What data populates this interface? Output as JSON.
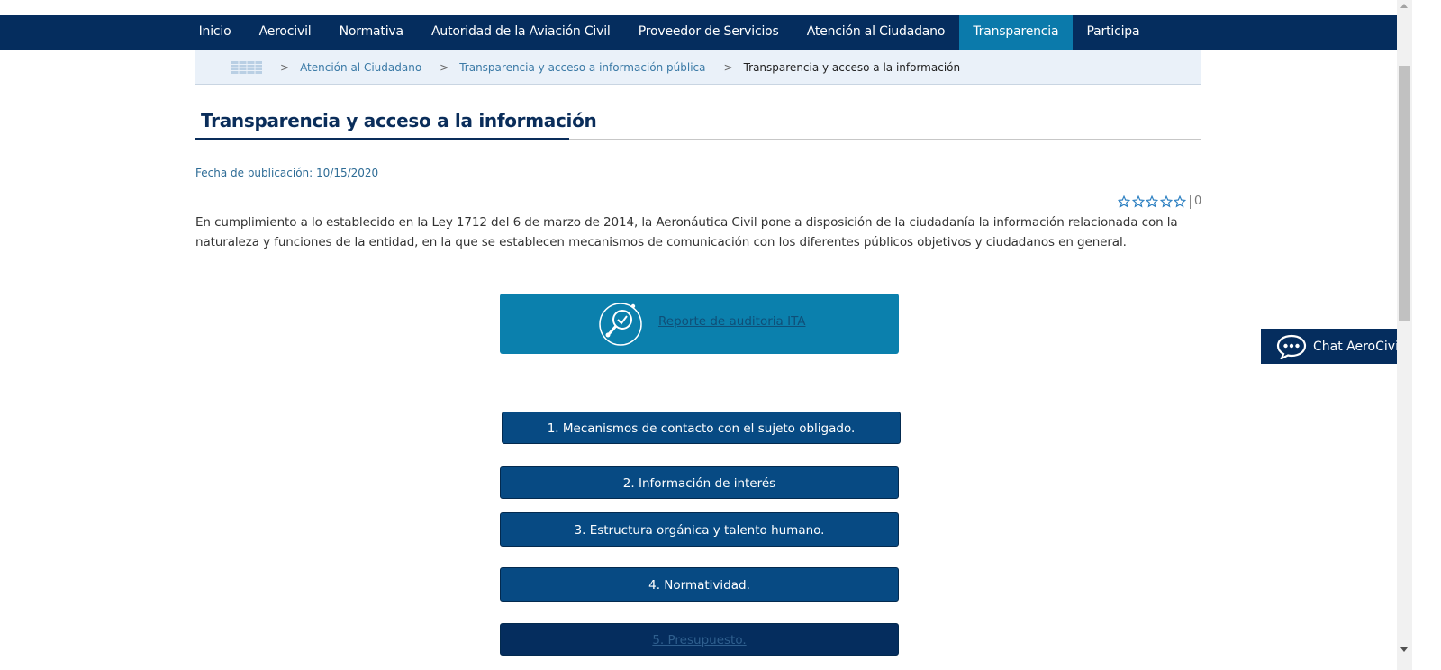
{
  "nav": {
    "items": [
      {
        "label": "Inicio"
      },
      {
        "label": "Aerocivil"
      },
      {
        "label": "Normativa"
      },
      {
        "label": "Autoridad de la Aviación Civil"
      },
      {
        "label": "Proveedor de Servicios"
      },
      {
        "label": "Atención al Ciudadano"
      },
      {
        "label": "Transparencia",
        "active": true
      },
      {
        "label": "Participa"
      }
    ]
  },
  "breadcrumb": {
    "separator": ">",
    "items": [
      "Atención al Ciudadano",
      "Transparencia y acceso a información pública"
    ],
    "current": "Transparencia y acceso a la información"
  },
  "page": {
    "title": "Transparencia y acceso a la información",
    "pubdate": "Fecha de publicación: 10/15/2020",
    "rating": {
      "count": "0",
      "stars": 5
    },
    "intro": "En cumplimiento a lo establecido en la Ley 1712 del 6 de marzo de 2014, la Aeronáutica Civil pone a disposición de la ciudadanía la información relacionada con la naturaleza y funciones de la entidad, en la que se establecen mecanismos de comunicación con los diferentes públicos objetivos y ciudadanos en general."
  },
  "ita": {
    "label": "Reporte de auditoria ITA",
    "icon": "search-clock-icon"
  },
  "sections": [
    {
      "label": "1. Mecanismos de contacto con el sujeto obligado."
    },
    {
      "label": "2. Información de interés"
    },
    {
      "label": "3. Estructura orgánica y talento humano."
    },
    {
      "label": "4. Normatividad."
    },
    {
      "label": "5. Presupuesto."
    }
  ],
  "chat": {
    "label": "Chat AeroCivil",
    "icon": "chat-bubble-icon"
  },
  "colors": {
    "nav_bg": "#052d5e",
    "nav_active": "#0b7aab",
    "ita_bg": "#0b80ad",
    "section_bg": "#074a83",
    "title": "#0a2d5a",
    "star": "#2b7fc1"
  }
}
